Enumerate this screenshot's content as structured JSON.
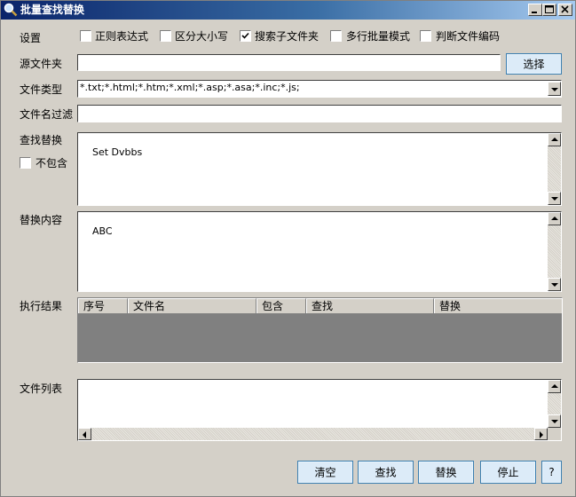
{
  "window": {
    "title": "批量查找替换",
    "buttons": [
      "minimize",
      "maximize",
      "close"
    ]
  },
  "settings": {
    "label": "设置",
    "options": [
      {
        "label": "正则表达式",
        "checked": false
      },
      {
        "label": "区分大小写",
        "checked": false
      },
      {
        "label": "搜索子文件夹",
        "checked": true
      },
      {
        "label": "多行批量模式",
        "checked": false
      },
      {
        "label": "判断文件编码",
        "checked": false
      }
    ]
  },
  "source_folder": {
    "label": "源文件夹",
    "value": "",
    "browse_label": "选择"
  },
  "file_type": {
    "label": "文件类型",
    "value": "*.txt;*.html;*.htm;*.xml;*.asp;*.asa;*.inc;*.js;"
  },
  "filename_filter": {
    "label": "文件名过滤",
    "value": ""
  },
  "find": {
    "label": "查找替换",
    "exclude_label": "不包含",
    "exclude_checked": false,
    "value": "Set Dvbbs"
  },
  "replace": {
    "label": "替换内容",
    "value": "ABC"
  },
  "results": {
    "label": "执行结果",
    "columns": [
      "序号",
      "文件名",
      "包含",
      "查找",
      "替换"
    ]
  },
  "file_list": {
    "label": "文件列表"
  },
  "footer": {
    "clear_label": "清空",
    "find_label": "查找",
    "replace_label": "替换",
    "stop_label": "停止",
    "help_label": "?"
  }
}
